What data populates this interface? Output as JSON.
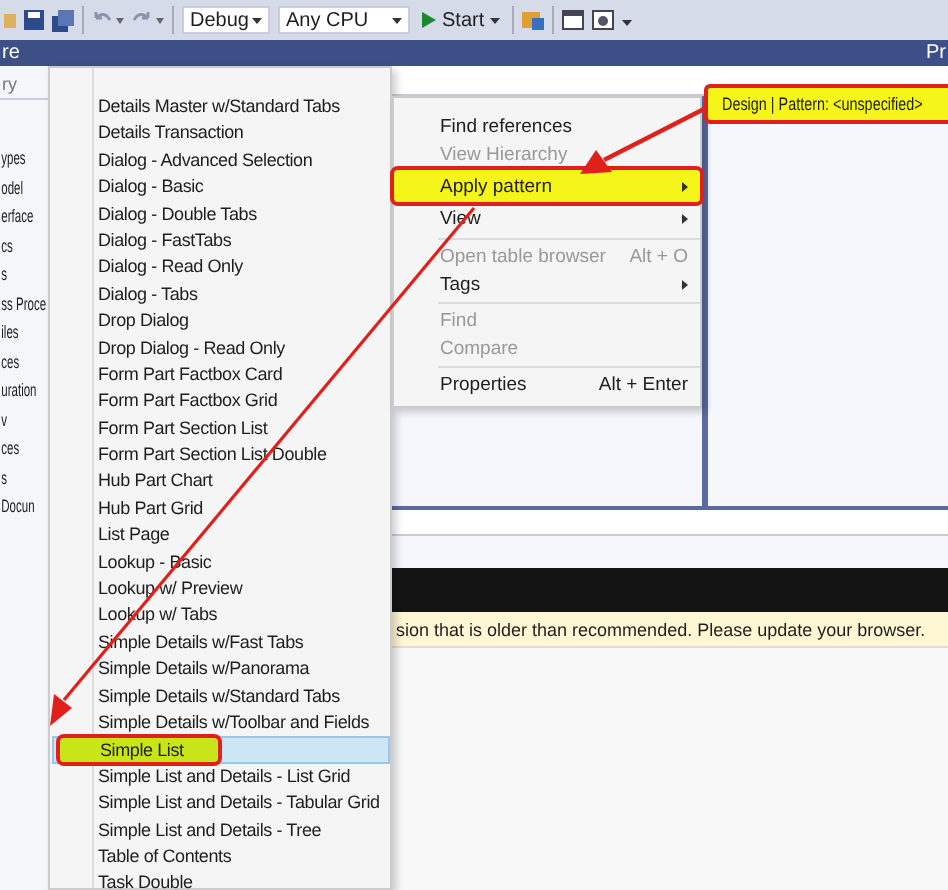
{
  "toolbar": {
    "configuration": "Debug",
    "platform": "Any CPU",
    "start": "Start"
  },
  "title_strip": {
    "left": "re",
    "right": "Pr"
  },
  "explorer": {
    "search": "ry",
    "items": [
      "ypes",
      "odel",
      "erface",
      "cs",
      "s",
      "ss Proce",
      "iles",
      "ces",
      "uration",
      "v",
      "ces",
      "s",
      "Docun"
    ]
  },
  "pattern_list": {
    "items": [
      {
        "label": "Details Master w/Standard Tabs",
        "selected": false
      },
      {
        "label": "Details Transaction",
        "selected": false
      },
      {
        "label": "Dialog - Advanced Selection",
        "selected": false
      },
      {
        "label": "Dialog - Basic",
        "selected": false
      },
      {
        "label": "Dialog - Double Tabs",
        "selected": false
      },
      {
        "label": "Dialog - FastTabs",
        "selected": false
      },
      {
        "label": "Dialog - Read Only",
        "selected": false
      },
      {
        "label": "Dialog - Tabs",
        "selected": false
      },
      {
        "label": "Drop Dialog",
        "selected": false
      },
      {
        "label": "Drop Dialog - Read Only",
        "selected": false
      },
      {
        "label": "Form Part Factbox Card",
        "selected": false
      },
      {
        "label": "Form Part Factbox Grid",
        "selected": false
      },
      {
        "label": "Form Part Section List",
        "selected": false
      },
      {
        "label": "Form Part Section List Double",
        "selected": false
      },
      {
        "label": "Hub Part Chart",
        "selected": false
      },
      {
        "label": "Hub Part Grid",
        "selected": false
      },
      {
        "label": "List Page",
        "selected": false
      },
      {
        "label": "Lookup - Basic",
        "selected": false
      },
      {
        "label": "Lookup w/ Preview",
        "selected": false
      },
      {
        "label": "Lookup w/ Tabs",
        "selected": false
      },
      {
        "label": "Simple Details w/Fast Tabs",
        "selected": false
      },
      {
        "label": "Simple Details w/Panorama",
        "selected": false
      },
      {
        "label": "Simple Details w/Standard Tabs",
        "selected": false
      },
      {
        "label": "Simple Details w/Toolbar and Fields",
        "selected": false
      },
      {
        "label": "Simple List",
        "selected": true
      },
      {
        "label": "Simple List and Details - List Grid",
        "selected": false
      },
      {
        "label": "Simple List and Details - Tabular Grid",
        "selected": false
      },
      {
        "label": "Simple List and Details - Tree",
        "selected": false
      },
      {
        "label": "Table of Contents",
        "selected": false
      },
      {
        "label": "Task Double",
        "selected": false
      }
    ]
  },
  "context_menu": {
    "items": [
      {
        "kind": "item",
        "label": "Find references",
        "disabled": false,
        "submenu": false,
        "selected": false
      },
      {
        "kind": "item",
        "label": "View Hierarchy",
        "disabled": true,
        "submenu": false,
        "selected": false
      },
      {
        "kind": "item",
        "label": "Apply pattern",
        "disabled": false,
        "submenu": true,
        "selected": true
      },
      {
        "kind": "item",
        "label": "View",
        "disabled": false,
        "submenu": true,
        "selected": false
      },
      {
        "kind": "separator"
      },
      {
        "kind": "item",
        "label": "Open table browser",
        "shortcut": "Alt + O",
        "disabled": true,
        "submenu": false,
        "selected": false
      },
      {
        "kind": "item",
        "label": "Tags",
        "disabled": false,
        "submenu": true,
        "selected": false
      },
      {
        "kind": "separator"
      },
      {
        "kind": "item",
        "label": "Find",
        "disabled": true,
        "submenu": false,
        "selected": false
      },
      {
        "kind": "item",
        "label": "Compare",
        "disabled": true,
        "submenu": false,
        "selected": false
      },
      {
        "kind": "separator"
      },
      {
        "kind": "item",
        "label": "Properties",
        "shortcut": "Alt + Enter",
        "disabled": false,
        "submenu": false,
        "selected": false
      }
    ]
  },
  "notice": "sion that is older than recommended. Please update your browser.",
  "pattern_badge": "Design | Pattern: <unspecified>"
}
